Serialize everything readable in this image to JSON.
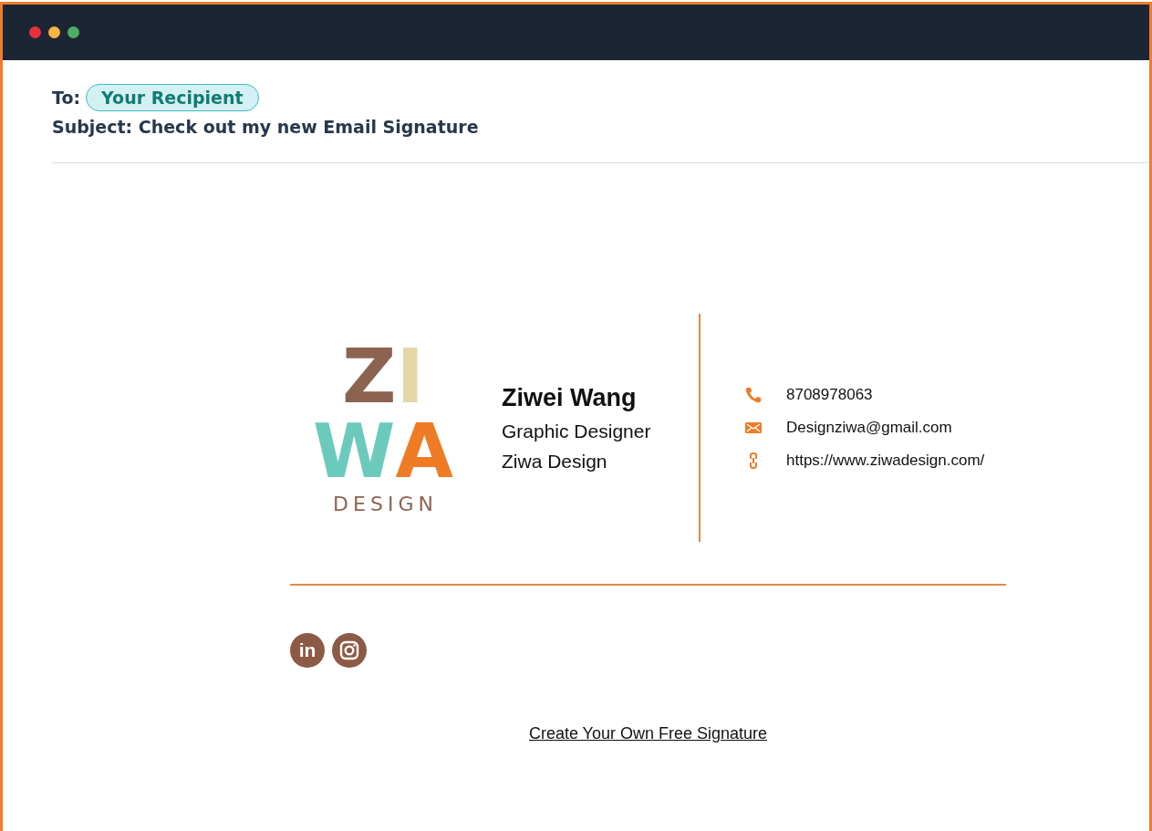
{
  "email": {
    "to_label": "To:",
    "recipient": "Your Recipient",
    "subject": "Subject: Check out my new Email Signature"
  },
  "signature": {
    "logo": {
      "rows": [
        [
          {
            "text": "Z",
            "color": "#8c6350"
          },
          {
            "text": "I",
            "color": "#e5d6a8"
          }
        ],
        [
          {
            "text": "W",
            "color": "#6ccabc"
          },
          {
            "text": "A",
            "color": "#ef7b25"
          }
        ]
      ],
      "caption": "DESIGN"
    },
    "name": "Ziwei Wang",
    "title": "Graphic Designer",
    "company": "Ziwa Design",
    "contacts": [
      {
        "kind": "phone",
        "text": "8708978063"
      },
      {
        "kind": "email",
        "text": "Designziwa@gmail.com"
      },
      {
        "kind": "link",
        "text": "https://www.ziwadesign.com/"
      }
    ],
    "social": [
      {
        "kind": "linkedin",
        "label": "in"
      },
      {
        "kind": "instagram"
      }
    ],
    "footer_link": "Create Your Own Free Signature"
  }
}
